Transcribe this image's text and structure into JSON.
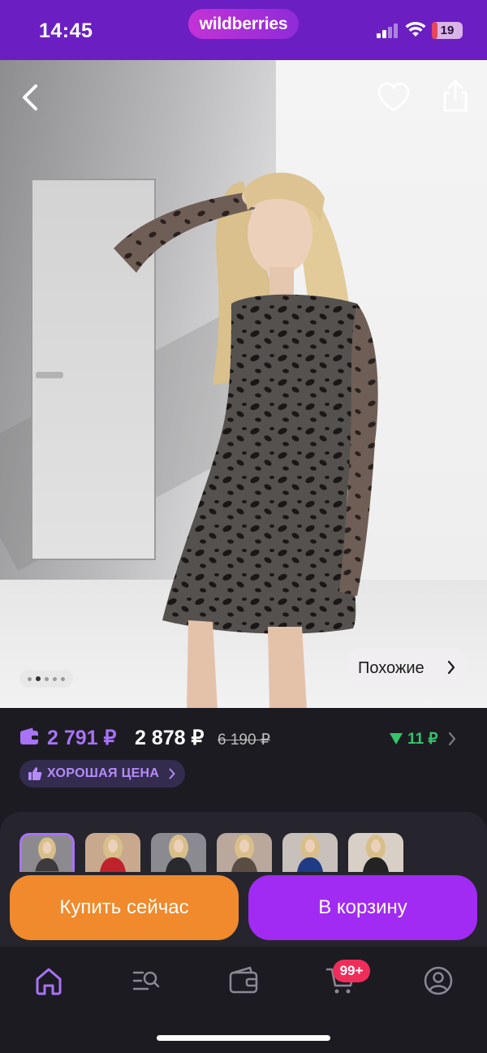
{
  "status_bar": {
    "time": "14:45",
    "app_logo": "wildberries",
    "battery_level": "19",
    "battery_fraction": 0.19,
    "icons": [
      "signal-icon",
      "wifi-icon",
      "battery-icon"
    ]
  },
  "photo": {
    "navigation": {
      "back_icon": "chevron-left-icon",
      "favorite_icon": "heart-icon",
      "share_icon": "share-icon"
    },
    "pager": {
      "count": 5,
      "active_index": 1
    },
    "similar_label": "Похожие"
  },
  "price": {
    "wallet_price": "2 791 ₽",
    "price": "2 878 ₽",
    "old_price": "6 190 ₽",
    "cashback": "11 ₽",
    "good_price_label": "ХОРОШАЯ ЦЕНА"
  },
  "thumbnails": [
    {
      "label": "photo-1",
      "selected": true,
      "bg": "#8c8a8e",
      "dress": "#3b3b3d"
    },
    {
      "label": "photo-2",
      "selected": false,
      "bg": "#c9a98e",
      "dress": "#c0222c"
    },
    {
      "label": "photo-3",
      "selected": false,
      "bg": "#8a8a90",
      "dress": "#2a2a2e"
    },
    {
      "label": "photo-4",
      "selected": false,
      "bg": "#b9a89b",
      "dress": "#5a4d44"
    },
    {
      "label": "photo-5",
      "selected": false,
      "bg": "#c8c0bb",
      "dress": "#1f3b85"
    },
    {
      "label": "photo-6",
      "selected": false,
      "bg": "#d8cfc6",
      "dress": "#232323"
    }
  ],
  "actions": {
    "buy_now": "Купить сейчас",
    "add_to_cart": "В корзину"
  },
  "tabbar": {
    "tabs": [
      "home-icon",
      "catalog-search-icon",
      "wallet-icon",
      "cart-icon",
      "profile-icon"
    ],
    "cart_badge": "99+"
  },
  "colors": {
    "brand_purple": "#6b1fc2",
    "accent_purple": "#a12bf2",
    "buy_orange": "#f08a2c",
    "cashback_green": "#35c46a",
    "badge_red": "#f02d5a"
  }
}
